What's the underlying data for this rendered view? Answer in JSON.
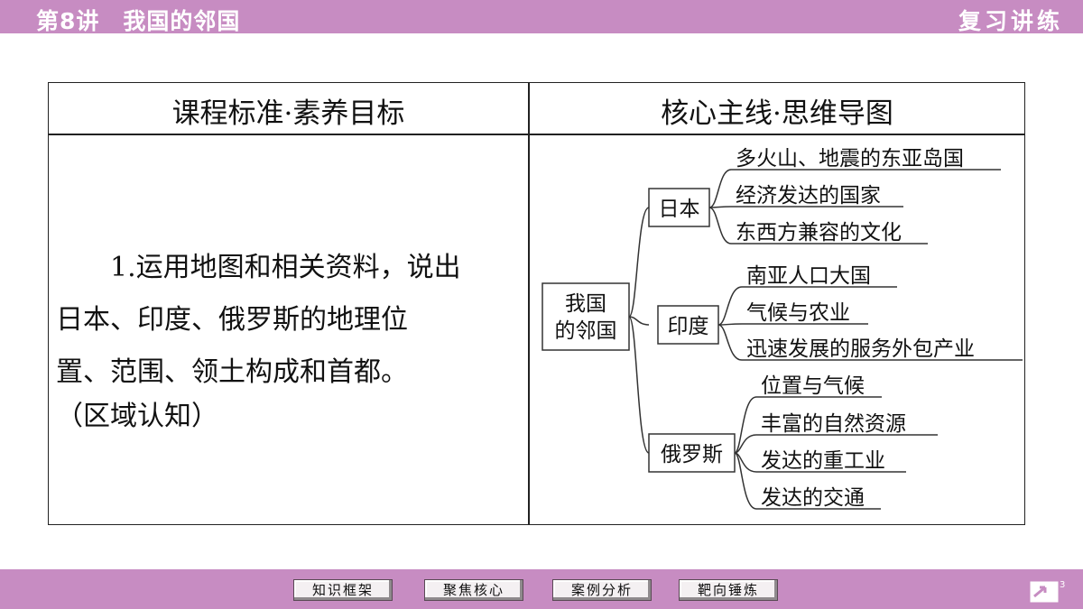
{
  "header": {
    "lesson": "第8讲",
    "title": "我国的邻国",
    "section": "复习讲练"
  },
  "table": {
    "left_header": "课程标准·素养目标",
    "right_header": "核心主线·思维导图",
    "left_lines": [
      "　　1.运用地图和相关资料，说出",
      "日本、印度、俄罗斯的地理位",
      "置、范围、领土构成和首都。",
      "（区域认知）"
    ]
  },
  "mindmap": {
    "root_line1": "我国",
    "root_line2": "的邻国",
    "japan": {
      "label": "日本",
      "items": [
        "多火山、地震的东亚岛国",
        "经济发达的国家",
        "东西方兼容的文化"
      ]
    },
    "india": {
      "label": "印度",
      "items": [
        "南亚人口大国",
        "气候与农业",
        "迅速发展的服务外包产业"
      ]
    },
    "russia": {
      "label": "俄罗斯",
      "items": [
        "位置与气候",
        "丰富的自然资源",
        "发达的重工业",
        "发达的交通"
      ]
    }
  },
  "footer": {
    "nav": [
      "知识框架",
      "聚焦核心",
      "案例分析",
      "靶向锤炼"
    ],
    "page_number": "3"
  },
  "colors": {
    "bar": "#c78cc2"
  }
}
